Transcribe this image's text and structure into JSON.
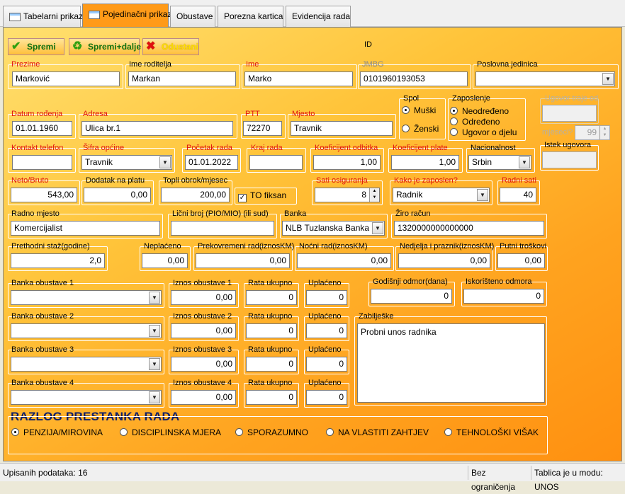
{
  "tabs": [
    {
      "label": "Tabelarni prikaz",
      "active": false
    },
    {
      "label": "Pojedinačni prikaz",
      "active": true
    },
    {
      "label": "Obustave",
      "active": false
    },
    {
      "label": "Porezna kartica",
      "active": false
    },
    {
      "label": "Evidencija rada",
      "active": false
    }
  ],
  "toolbar": {
    "save": "Spremi",
    "save_next": "Spremi+dalje",
    "cancel": "Odustani",
    "id_label": "ID"
  },
  "labels": {
    "prezime": "Prezime",
    "ime_roditelja": "Ime roditelja",
    "ime": "Ime",
    "jmbg": "JMBG",
    "poslovna_jedinica": "Poslovna jedinica",
    "datum_rodjenja": "Datum rođenja",
    "adresa": "Adresa",
    "ptt": "PTT",
    "mjesto": "Mjesto",
    "spol": "Spol",
    "zaposlenje": "Zaposlenje",
    "ugovor_od": "Ugovor traje od",
    "mjeseci": "mjeseci?",
    "istek": "Istek ugovora",
    "kontakt": "Kontakt telefon",
    "sifra_opcine": "Šifra općine",
    "pocetak_rada": "Početak rada",
    "kraj_rada": "Kraj rada",
    "koef_odbitka": "Koeficijent odbitka",
    "koef_plate": "Koeficijent plate",
    "nacionalnost": "Nacionalnost",
    "neto_bruto": "Neto/Bruto",
    "dodatak": "Dodatak na platu",
    "topli": "Topli obrok/mjesec",
    "to_fiksan": "TO fiksan",
    "sati_osig": "Sati osiguranja",
    "kako_zaposlen": "Kako je zaposlen?",
    "radni_sati": "Radni sati",
    "radno_mjesto": "Radno mjesto",
    "licni_broj": "Lični broj (PIO/MIO) (ili sud)",
    "banka": "Banka",
    "ziro": "Žiro račun",
    "staz": "Prethodni staž(godine)",
    "neplaceno": "Neplaćeno",
    "prekovremeni": "Prekovremeni rad(iznosKM)",
    "nocni": "Noćni rad(iznosKM)",
    "nedjelja": "Nedjelja i praznik(iznosKM)",
    "putni": "Putni troškovi",
    "godisnji": "Godišnji odmor(dana)",
    "iskoristeno": "Iskorišteno odmora",
    "zabiljeske": "Zabilješke",
    "rata": "Rata ukupno",
    "uplaceno": "Uplaćeno"
  },
  "values": {
    "prezime": "Marković",
    "ime_roditelja": "Markan",
    "ime": "Marko",
    "jmbg": "0101960193053",
    "poslovna_jedinica": "",
    "datum_rodjenja": "01.01.1960",
    "adresa": "Ulica br.1",
    "ptt": "72270",
    "mjesto": "Travnik",
    "ugovor_od": "",
    "mjeseci": "99",
    "istek": "",
    "kontakt": "",
    "sifra_opcine": "Travnik",
    "pocetak_rada": "01.01.2022",
    "kraj_rada": "",
    "koef_odbitka": "1,00",
    "koef_plate": "1,00",
    "nacionalnost": "Srbin",
    "neto_bruto": "543,00",
    "dodatak": "0,00",
    "topli": "200,00",
    "sati_osig": "8",
    "kako_zaposlen": "Radnik",
    "radni_sati": "40",
    "radno_mjesto": "Komercijalist",
    "licni_broj": "",
    "banka": "NLB Tuzlanska Banka",
    "ziro": "1320000000000000",
    "staz": "2,0",
    "neplaceno": "0,00",
    "prekovremeni": "0,00",
    "nocni": "0,00",
    "nedjelja": "0,00",
    "putni": "0,00",
    "godisnji": "0",
    "iskoristeno": "0",
    "zabiljeske": "Probni unos radnika"
  },
  "spol": {
    "options": [
      "Muški",
      "Ženski"
    ],
    "selected": "Muški"
  },
  "zaposlenje": {
    "options": [
      "Neodređeno",
      "Određeno",
      "Ugovor o djelu"
    ],
    "selected": "Neodređeno"
  },
  "to_fiksan_checked": true,
  "obustave": [
    {
      "banka_label": "Banka obustave 1",
      "iznos_label": "Iznos obustave 1",
      "banka": "",
      "iznos": "0,00",
      "rata": "0",
      "uplaceno": "0"
    },
    {
      "banka_label": "Banka obustave 2",
      "iznos_label": "Iznos obustave 2",
      "banka": "",
      "iznos": "0,00",
      "rata": "0",
      "uplaceno": "0"
    },
    {
      "banka_label": "Banka obustave 3",
      "iznos_label": "Iznos obustave 3",
      "banka": "",
      "iznos": "0,00",
      "rata": "0",
      "uplaceno": "0"
    },
    {
      "banka_label": "Banka obustave 4",
      "iznos_label": "Iznos obustave 4",
      "banka": "",
      "iznos": "0,00",
      "rata": "0",
      "uplaceno": "0"
    }
  ],
  "razlog": {
    "title": "RAZLOG PRESTANKA RADA",
    "options": [
      "PENZIJA/MIROVINA",
      "DISCIPLINSKA MJERA",
      "SPORAZUMNO",
      "NA VLASTITI ZAHTJEV",
      "TEHNOLOŠKI VIŠAK"
    ],
    "selected": "PENZIJA/MIROVINA"
  },
  "status": {
    "count": "Upisanih podataka: 16",
    "limit": "Bez ograničenja",
    "mode": "Tablica je u modu: UNOS"
  }
}
